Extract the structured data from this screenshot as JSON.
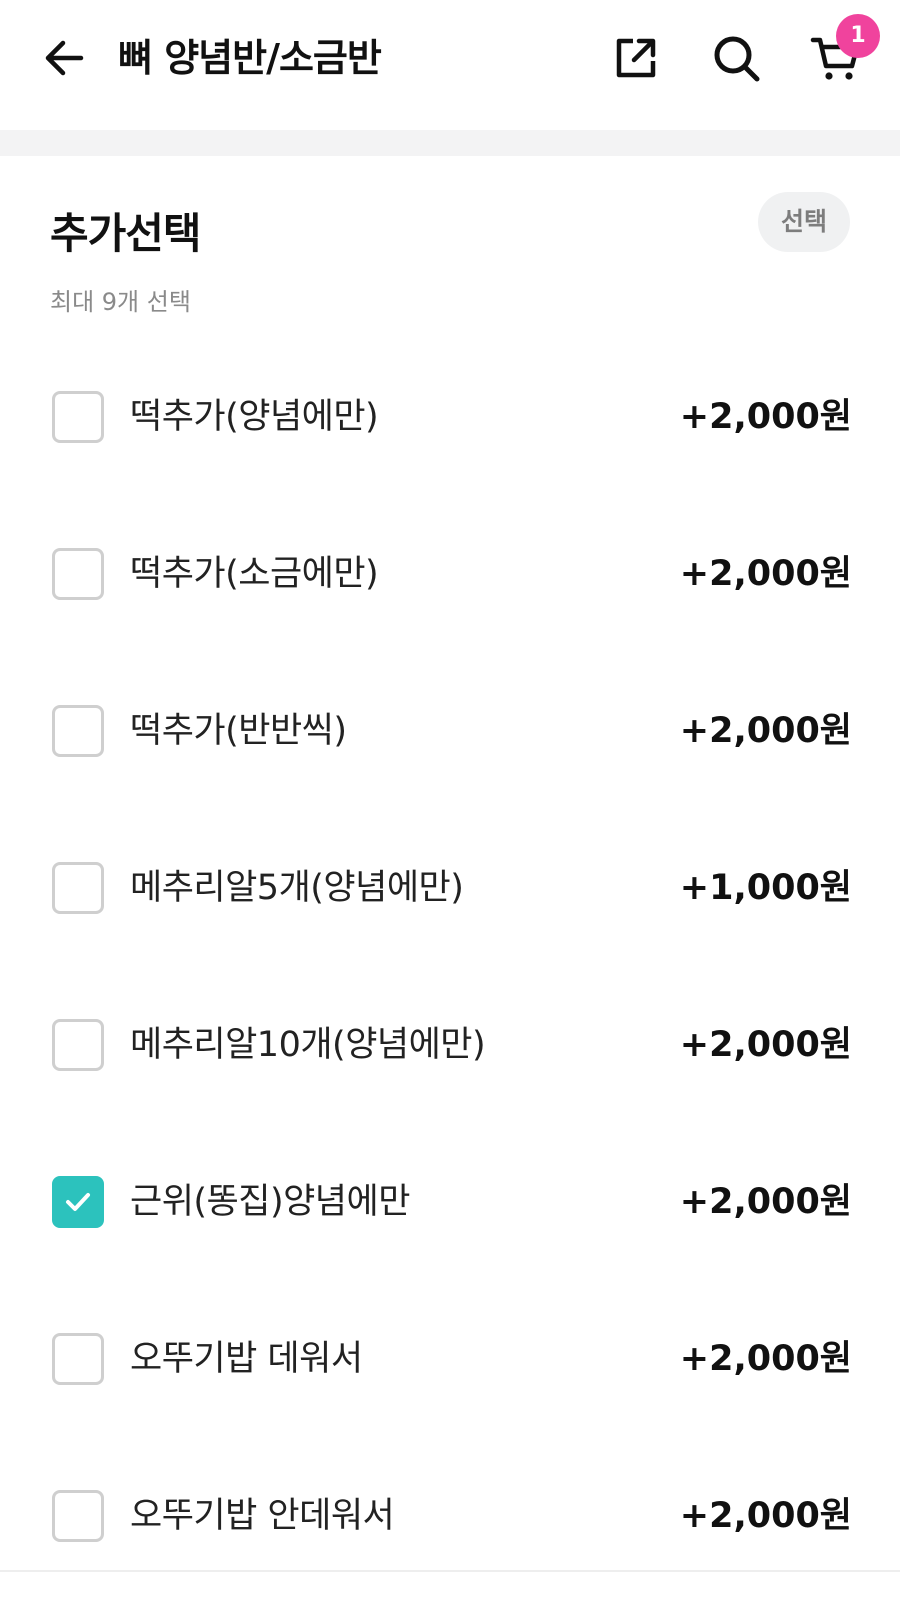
{
  "header": {
    "title": "뼈 양념반/소금반",
    "icons": [
      "back-arrow-icon",
      "share-icon",
      "search-icon",
      "cart-icon"
    ],
    "cart_badge": "1"
  },
  "section": {
    "title": "추가선택",
    "subtitle": "최대 9개 선택",
    "pill_label": "선택"
  },
  "options": [
    {
      "label": "떡추가(양념에만)",
      "price": "+2,000원",
      "checked": false
    },
    {
      "label": "떡추가(소금에만)",
      "price": "+2,000원",
      "checked": false
    },
    {
      "label": "떡추가(반반씩)",
      "price": "+2,000원",
      "checked": false
    },
    {
      "label": "메추리알5개(양념에만)",
      "price": "+1,000원",
      "checked": false
    },
    {
      "label": "메추리알10개(양념에만)",
      "price": "+2,000원",
      "checked": false
    },
    {
      "label": "근위(똥집)양념에만",
      "price": "+2,000원",
      "checked": true
    },
    {
      "label": "오뚜기밥 데워서",
      "price": "+2,000원",
      "checked": false
    },
    {
      "label": "오뚜기밥 안데워서",
      "price": "+2,000원",
      "checked": false
    }
  ],
  "colors": {
    "accent_teal": "#2cc2bd",
    "badge_pink": "#f0439d"
  }
}
